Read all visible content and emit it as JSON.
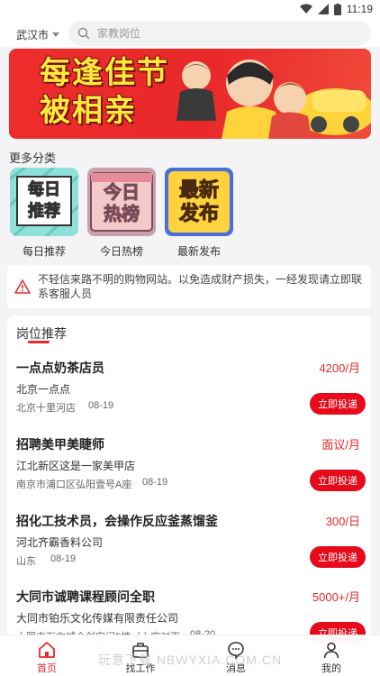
{
  "status": {
    "time": "11:19"
  },
  "top": {
    "city": "武汉市",
    "search_placeholder": "家教岗位"
  },
  "banner": {
    "line1": "每逢佳节",
    "line2": "被相亲"
  },
  "more_categories": "更多分类",
  "categories": [
    {
      "label": "每日推荐",
      "img_line1": "每日",
      "img_line2": "推荐"
    },
    {
      "label": "今日热榜",
      "img_line1": "今日",
      "img_line2": "热榜"
    },
    {
      "label": "最新发布",
      "img_line1": "最新",
      "img_line2": "发布"
    }
  ],
  "notice": {
    "text": "不轻信来路不明的购物网站。以免造成财产损失，一经发现请立即联系客服人员"
  },
  "jobs_section": {
    "title": "岗位推荐"
  },
  "jobs": [
    {
      "title": "一点点奶茶店员",
      "salary": "4200/月",
      "company": "北京一点点",
      "location": "北京十里河店",
      "date": "08-19",
      "apply": "立即投递"
    },
    {
      "title": "招聘美甲美睫师",
      "salary": "面议/月",
      "company": "江北新区这是一家美甲店",
      "location": "南京市浦口区弘阳壹号A座",
      "date": "08-19",
      "apply": "立即投递"
    },
    {
      "title": "招化工技术员，会操作反应釜蒸馏釜",
      "salary": "300/日",
      "company": "河北齐霸香料公司",
      "location": "山东",
      "date": "08-19",
      "apply": "立即投递"
    },
    {
      "title": "大同市诚聘课程顾问全职",
      "salary": "5000+/月",
      "company": "大同市铂乐文化传媒有限责任公司",
      "location": "大同市万向城众创空间5楼（上席对面",
      "date": "08-20",
      "apply": "立即投递"
    }
  ],
  "watermark": "玩意下载 NBWYXIA.COM.CN",
  "tabbar": [
    {
      "label": "首页",
      "icon": "home-icon"
    },
    {
      "label": "找工作",
      "icon": "briefcase-icon"
    },
    {
      "label": "消息",
      "icon": "message-icon"
    },
    {
      "label": "我的",
      "icon": "user-icon"
    }
  ],
  "colors": {
    "accent": "#e8282b",
    "button": "#e60a1a",
    "banner": "#ee2c2c"
  }
}
